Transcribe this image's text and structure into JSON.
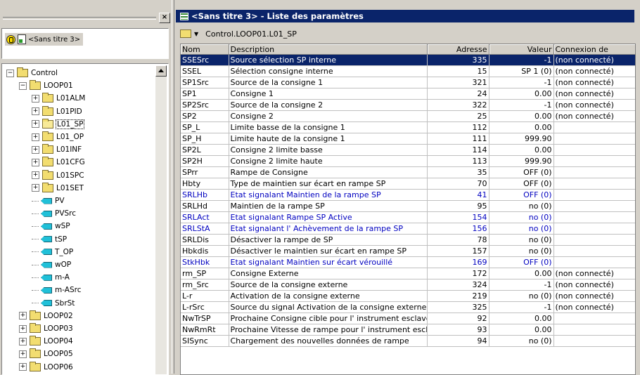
{
  "left": {
    "close_glyph": "×",
    "project_label": "<Sans titre 3>",
    "tree": [
      {
        "label": "Control",
        "type": "folder",
        "expander": "−",
        "level": 0
      },
      {
        "label": "LOOP01",
        "type": "folder",
        "expander": "−",
        "level": 1
      },
      {
        "label": "L01ALM",
        "type": "folder",
        "expander": "+",
        "level": 2
      },
      {
        "label": "L01PID",
        "type": "folder",
        "expander": "+",
        "level": 2
      },
      {
        "label": "L01_SP",
        "type": "folder-open",
        "expander": "+",
        "level": 2,
        "selected": true
      },
      {
        "label": "L01_OP",
        "type": "folder",
        "expander": "+",
        "level": 2
      },
      {
        "label": "L01INF",
        "type": "folder",
        "expander": "+",
        "level": 2
      },
      {
        "label": "L01CFG",
        "type": "folder",
        "expander": "+",
        "level": 2
      },
      {
        "label": "L01SPC",
        "type": "folder",
        "expander": "+",
        "level": 2
      },
      {
        "label": "L01SET",
        "type": "folder",
        "expander": "+",
        "level": 2
      },
      {
        "label": "PV",
        "type": "param",
        "level": 2
      },
      {
        "label": "PVSrc",
        "type": "param",
        "level": 2
      },
      {
        "label": "wSP",
        "type": "param",
        "level": 2
      },
      {
        "label": "tSP",
        "type": "param",
        "level": 2
      },
      {
        "label": "T_OP",
        "type": "param",
        "level": 2
      },
      {
        "label": "wOP",
        "type": "param",
        "level": 2
      },
      {
        "label": "m-A",
        "type": "param",
        "level": 2
      },
      {
        "label": "m-ASrc",
        "type": "param",
        "level": 2
      },
      {
        "label": "SbrSt",
        "type": "param",
        "level": 2
      },
      {
        "label": "LOOP02",
        "type": "folder",
        "expander": "+",
        "level": 1
      },
      {
        "label": "LOOP03",
        "type": "folder",
        "expander": "+",
        "level": 1
      },
      {
        "label": "LOOP04",
        "type": "folder",
        "expander": "+",
        "level": 1
      },
      {
        "label": "LOOP05",
        "type": "folder",
        "expander": "+",
        "level": 1
      },
      {
        "label": "LOOP06",
        "type": "folder",
        "expander": "+",
        "level": 1
      }
    ]
  },
  "window": {
    "title": "<Sans titre 3> - Liste des paramètres",
    "path": "Control.LOOP01.L01_SP",
    "caret": "▼"
  },
  "table": {
    "columns": [
      "Nom",
      "Description",
      "Adresse",
      "Valeur",
      "Connexion de"
    ],
    "rows": [
      {
        "name": "SSESrc",
        "desc": "Source sélection SP interne",
        "addr": "335",
        "val": "-1",
        "conn": "(non connecté)",
        "style": "selected"
      },
      {
        "name": "SSEL",
        "desc": "Sélection consigne interne",
        "addr": "15",
        "val": "SP 1 (0)",
        "conn": "(non connecté)",
        "style": ""
      },
      {
        "name": "SP1Src",
        "desc": "Source de la consigne 1",
        "addr": "321",
        "val": "-1",
        "conn": "(non connecté)",
        "style": ""
      },
      {
        "name": "SP1",
        "desc": "Consigne 1",
        "addr": "24",
        "val": "0.00",
        "conn": "(non connecté)",
        "style": ""
      },
      {
        "name": "SP2Src",
        "desc": "Source de la consigne 2",
        "addr": "322",
        "val": "-1",
        "conn": "(non connecté)",
        "style": ""
      },
      {
        "name": "SP2",
        "desc": "Consigne 2",
        "addr": "25",
        "val": "0.00",
        "conn": "(non connecté)",
        "style": ""
      },
      {
        "name": "SP_L",
        "desc": "Limite basse de la consigne 1",
        "addr": "112",
        "val": "0.00",
        "conn": "",
        "style": ""
      },
      {
        "name": "SP_H",
        "desc": "Limite haute de la consigne 1",
        "addr": "111",
        "val": "999.90",
        "conn": "",
        "style": ""
      },
      {
        "name": "SP2L",
        "desc": "Consigne 2 limite basse",
        "addr": "114",
        "val": "0.00",
        "conn": "",
        "style": ""
      },
      {
        "name": "SP2H",
        "desc": "Consigne 2 limite haute",
        "addr": "113",
        "val": "999.90",
        "conn": "",
        "style": ""
      },
      {
        "name": "SPrr",
        "desc": "Rampe de Consigne",
        "addr": "35",
        "val": "OFF (0)",
        "conn": "",
        "style": ""
      },
      {
        "name": "Hbty",
        "desc": "Type de maintien sur écart en rampe SP",
        "addr": "70",
        "val": "OFF (0)",
        "conn": "",
        "style": ""
      },
      {
        "name": "SRLHb",
        "desc": "Etat signalant Maintien de la rampe SP",
        "addr": "41",
        "val": "OFF (0)",
        "conn": "",
        "style": "blue"
      },
      {
        "name": "SRLHd",
        "desc": "Maintien de la rampe SP",
        "addr": "95",
        "val": "no (0)",
        "conn": "",
        "style": ""
      },
      {
        "name": "SRLAct",
        "desc": "Etat signalant Rampe SP Active",
        "addr": "154",
        "val": "no (0)",
        "conn": "",
        "style": "blue"
      },
      {
        "name": "SRLStA",
        "desc": "Etat signalant l' Achèvement de la rampe SP",
        "addr": "156",
        "val": "no (0)",
        "conn": "",
        "style": "blue"
      },
      {
        "name": "SRLDis",
        "desc": "Désactiver la rampe de SP",
        "addr": "78",
        "val": "no (0)",
        "conn": "",
        "style": ""
      },
      {
        "name": "Hbkdis",
        "desc": "Désactiver le maintien sur écart en rampe SP",
        "addr": "157",
        "val": "no (0)",
        "conn": "",
        "style": ""
      },
      {
        "name": "StkHbk",
        "desc": "Etat signalant Maintien sur écart vérouillé",
        "addr": "169",
        "val": "OFF (0)",
        "conn": "",
        "style": "blue"
      },
      {
        "name": "rm_SP",
        "desc": "Consigne Externe",
        "addr": "172",
        "val": "0.00",
        "conn": "(non connecté)",
        "style": ""
      },
      {
        "name": "rm_Src",
        "desc": "Source de la consigne externe",
        "addr": "324",
        "val": "-1",
        "conn": "(non connecté)",
        "style": ""
      },
      {
        "name": "L-r",
        "desc": "Activation de la consigne externe",
        "addr": "219",
        "val": "no (0)",
        "conn": "(non connecté)",
        "style": ""
      },
      {
        "name": "L-rSrc",
        "desc": "Source du signal Activation de la consigne externe",
        "addr": "325",
        "val": "-1",
        "conn": "(non connecté)",
        "style": ""
      },
      {
        "name": "NwTrSP",
        "desc": "Prochaine Consigne cible pour l' instrument esclave",
        "addr": "92",
        "val": "0.00",
        "conn": "",
        "style": ""
      },
      {
        "name": "NwRmRt",
        "desc": "Prochaine Vitesse de rampe pour l' instrument esclave",
        "addr": "93",
        "val": "0.00",
        "conn": "",
        "style": ""
      },
      {
        "name": "SISync",
        "desc": "Chargement des nouvelles données de rampe",
        "addr": "94",
        "val": "no (0)",
        "conn": "",
        "style": ""
      }
    ]
  }
}
